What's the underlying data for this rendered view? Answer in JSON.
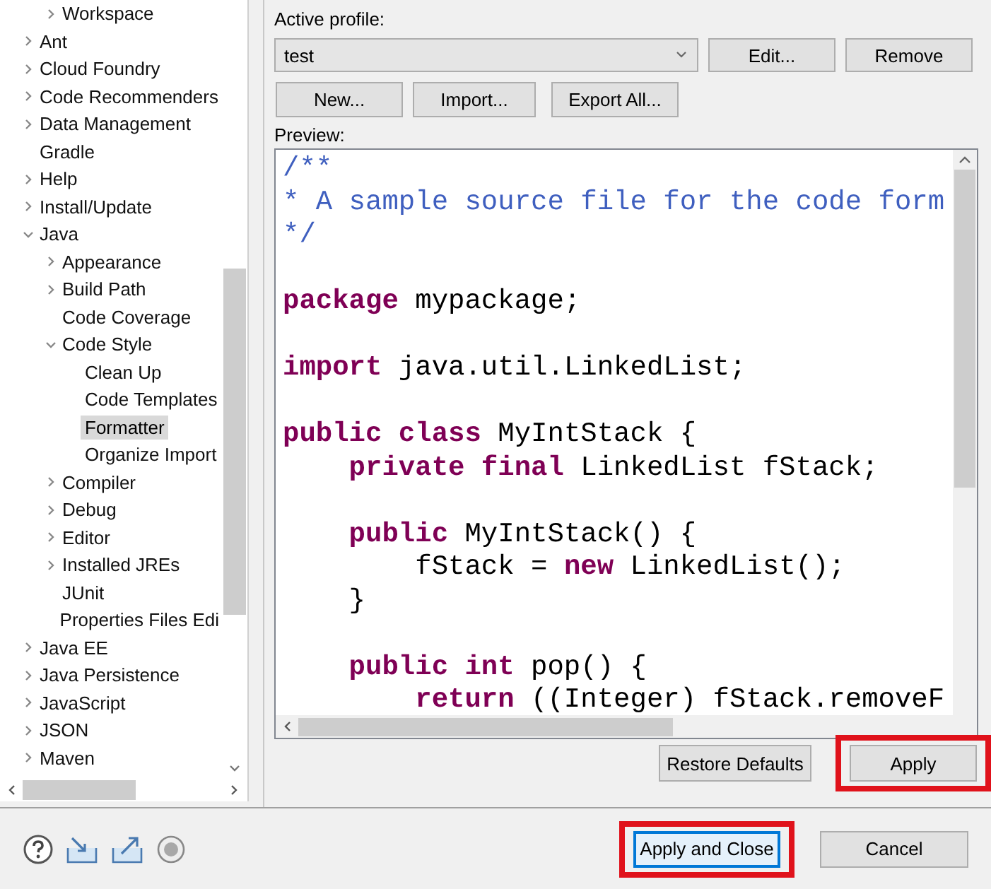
{
  "tree": {
    "items": [
      {
        "children": [
          {
            "label": "Workspace",
            "expanded": false,
            "selected": false
          }
        ]
      },
      {
        "label": "Ant",
        "expanded": false,
        "selected": false
      },
      {
        "label": "Cloud Foundry",
        "expanded": false,
        "selected": false
      },
      {
        "label": "Code Recommenders",
        "expanded": false,
        "selected": false
      },
      {
        "label": "Data Management",
        "expanded": false,
        "selected": false
      },
      {
        "label": "Gradle",
        "selected": false
      },
      {
        "label": "Help",
        "expanded": false,
        "selected": false
      },
      {
        "label": "Install/Update",
        "expanded": false,
        "selected": false
      },
      {
        "label": "Java",
        "expanded": true,
        "selected": false,
        "children": [
          {
            "label": "Appearance",
            "expanded": false,
            "selected": false
          },
          {
            "label": "Build Path",
            "expanded": false,
            "selected": false
          },
          {
            "label": "Code Coverage",
            "selected": false
          },
          {
            "label": "Code Style",
            "expanded": true,
            "selected": false,
            "children": [
              {
                "label": "Clean Up",
                "selected": false
              },
              {
                "label": "Code Templates",
                "selected": false
              },
              {
                "label": "Formatter",
                "selected": true
              },
              {
                "label": "Organize Import",
                "selected": false
              }
            ]
          },
          {
            "label": "Compiler",
            "expanded": false,
            "selected": false
          },
          {
            "label": "Debug",
            "expanded": false,
            "selected": false
          },
          {
            "label": "Editor",
            "expanded": false,
            "selected": false
          },
          {
            "label": "Installed JREs",
            "expanded": false,
            "selected": false
          },
          {
            "label": "JUnit",
            "selected": false
          },
          {
            "label": "Properties Files Edi",
            "selected": false
          }
        ]
      },
      {
        "label": "Java EE",
        "expanded": false,
        "selected": false
      },
      {
        "label": "Java Persistence",
        "expanded": false,
        "selected": false
      },
      {
        "label": "JavaScript",
        "expanded": false,
        "selected": false
      },
      {
        "label": "JSON",
        "expanded": false,
        "selected": false
      },
      {
        "label": "Maven",
        "expanded": false,
        "selected": false
      }
    ]
  },
  "profile": {
    "label": "Active profile:",
    "value": "test",
    "buttons": [
      "Edit...",
      "Remove"
    ],
    "actions": [
      "New...",
      "Import...",
      "Export All..."
    ]
  },
  "preview": {
    "label": "Preview:",
    "lines": [
      {
        "kind": "code",
        "tokens": [
          {
            "kind": "comment",
            "text": "/**"
          }
        ]
      },
      {
        "kind": "code",
        "tokens": [
          {
            "kind": "comment",
            "text": "* A sample source file for the code form"
          }
        ]
      },
      {
        "kind": "code",
        "tokens": [
          {
            "kind": "comment",
            "text": "*/"
          }
        ]
      },
      {
        "kind": "blank"
      },
      {
        "kind": "code",
        "tokens": [
          {
            "kind": "keyword",
            "text": "package"
          },
          {
            "kind": "plain",
            "text": " mypackage;"
          }
        ]
      },
      {
        "kind": "blank"
      },
      {
        "kind": "code",
        "tokens": [
          {
            "kind": "keyword",
            "text": "import"
          },
          {
            "kind": "plain",
            "text": " java.util.LinkedList;"
          }
        ]
      },
      {
        "kind": "blank"
      },
      {
        "kind": "code",
        "tokens": [
          {
            "kind": "keyword",
            "text": "public class"
          },
          {
            "kind": "plain",
            "text": " MyIntStack {"
          }
        ]
      },
      {
        "kind": "code",
        "tokens": [
          {
            "kind": "keyword",
            "text": "    private final"
          },
          {
            "kind": "plain",
            "text": " LinkedList fStack;"
          }
        ]
      },
      {
        "kind": "blank"
      },
      {
        "kind": "code",
        "tokens": [
          {
            "kind": "keyword",
            "text": "    public"
          },
          {
            "kind": "plain",
            "text": " MyIntStack() {"
          }
        ]
      },
      {
        "kind": "code",
        "tokens": [
          {
            "kind": "plain",
            "text": "        fStack = "
          },
          {
            "kind": "keyword",
            "text": "new"
          },
          {
            "kind": "plain",
            "text": " LinkedList();"
          }
        ]
      },
      {
        "kind": "code",
        "tokens": [
          {
            "kind": "plain",
            "text": "    }"
          }
        ]
      },
      {
        "kind": "blank"
      },
      {
        "kind": "code",
        "tokens": [
          {
            "kind": "keyword",
            "text": "    public int"
          },
          {
            "kind": "plain",
            "text": " pop() {"
          }
        ]
      },
      {
        "kind": "code",
        "tokens": [
          {
            "kind": "keyword",
            "text": "        return"
          },
          {
            "kind": "plain",
            "text": " ((Integer) fStack.removeF"
          }
        ]
      }
    ]
  },
  "page_buttons": [
    {
      "label": "Restore Defaults",
      "highlighted": false,
      "default": false
    },
    {
      "label": "Apply",
      "highlighted": true,
      "default": false
    }
  ],
  "dialog_buttons": [
    {
      "label": "Apply and Close",
      "highlighted": true,
      "default": true
    },
    {
      "label": "Cancel",
      "highlighted": false,
      "default": false
    }
  ]
}
